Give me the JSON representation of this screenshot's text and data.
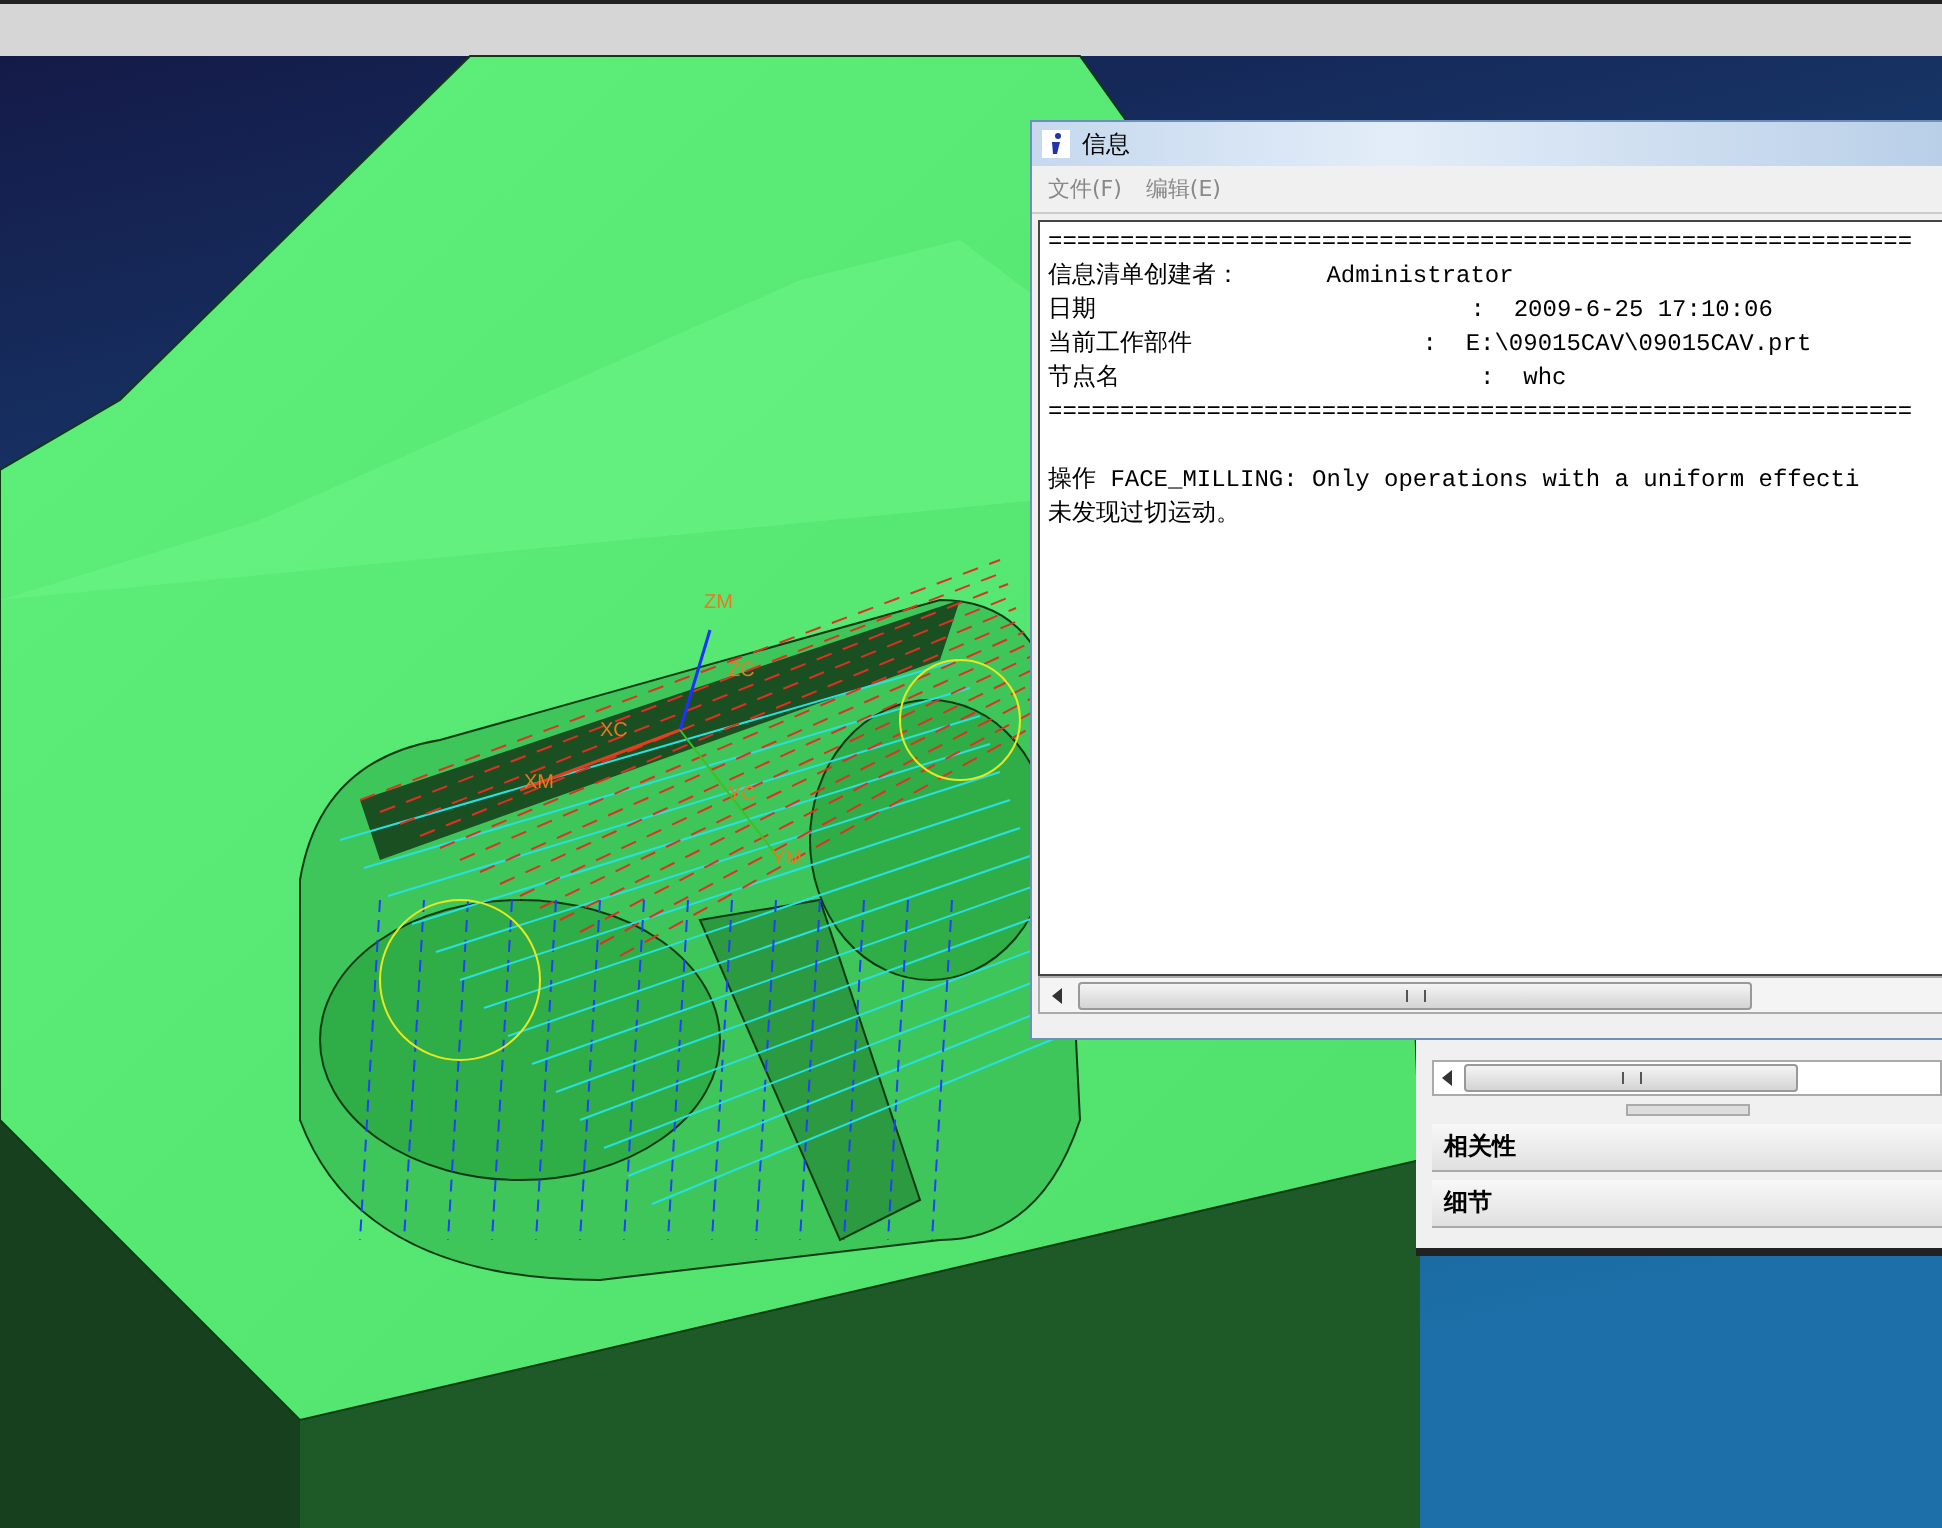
{
  "viewport": {
    "axis_labels": [
      {
        "text": "ZM",
        "kind": "work"
      },
      {
        "text": "ZC",
        "kind": "work"
      },
      {
        "text": "XC",
        "kind": "work"
      },
      {
        "text": "XM",
        "kind": "work"
      },
      {
        "text": "YC",
        "kind": "work"
      },
      {
        "text": "YM",
        "kind": "work"
      }
    ]
  },
  "side_panel": {
    "sections": [
      {
        "label": "相关性"
      },
      {
        "label": "细节"
      }
    ]
  },
  "info_window": {
    "title": "信息",
    "menu": [
      "文件(F)",
      "编辑(E)"
    ],
    "lines": [
      {
        "kind": "rule",
        "text": "============================================================"
      },
      {
        "kind": "text",
        "text": "信息清单创建者：      Administrator"
      },
      {
        "kind": "text",
        "text": "日期                          :  2009-6-25 17:10:06"
      },
      {
        "kind": "text",
        "text": "当前工作部件                :  E:\\09015CAV\\09015CAV.prt"
      },
      {
        "kind": "text",
        "text": "节点名                         :  whc"
      },
      {
        "kind": "rule",
        "text": "============================================================"
      },
      {
        "kind": "blank"
      },
      {
        "kind": "text",
        "text": "操作 FACE_MILLING: Only operations with a uniform effecti"
      },
      {
        "kind": "text",
        "text": "未发现过切运动。"
      }
    ]
  }
}
